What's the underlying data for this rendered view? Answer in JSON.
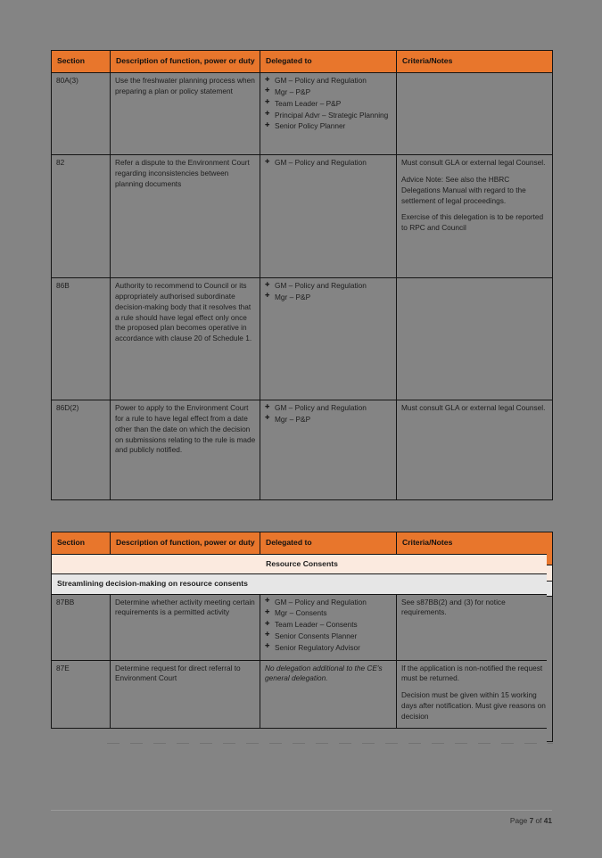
{
  "document": {
    "footer": {
      "page_label_prefix": "Page ",
      "current_page": "7",
      "middle": " of ",
      "total_pages": "41"
    }
  },
  "table1": {
    "headers": {
      "section": "Section",
      "description": "Description of function, power or duty",
      "delegated_to": "Delegated to",
      "criteria": "Criteria/Notes"
    },
    "rows": [
      {
        "section": "80A(3)",
        "description": "Use the freshwater planning process when preparing a plan or policy statement",
        "delegated_to": [
          "GM – Policy and Regulation",
          "Mgr – P&P",
          "Team Leader – P&P",
          "Principal Advr – Strategic Planning",
          "Senior Policy Planner"
        ],
        "criteria": []
      },
      {
        "section": "82",
        "description": "Refer a dispute to the Environment Court regarding inconsistencies between planning documents",
        "delegated_to": [
          "GM – Policy and Regulation"
        ],
        "criteria": [
          "Must consult GLA or external legal Counsel.",
          "Advice Note: See also the HBRC Delegations Manual with regard to the settlement of legal proceedings.",
          "Exercise of this delegation is to be reported to RPC and Council"
        ]
      },
      {
        "section": "86B",
        "description": "Authority to recommend to Council or its appropriately authorised subordinate decision-making body that it resolves that a rule should have legal effect only once the proposed plan becomes operative in accordance with clause 20 of Schedule 1.",
        "delegated_to": [
          "GM – Policy and Regulation",
          "Mgr – P&P"
        ],
        "criteria": []
      },
      {
        "section": "86D(2)",
        "description": "Power to apply to the Environment Court for a rule to have legal effect from a date other than the date on which the decision on submissions relating to the rule is made and publicly notified.",
        "delegated_to": [
          "GM – Policy and Regulation",
          "Mgr – P&P"
        ],
        "criteria": [
          "Must consult GLA or external legal Counsel."
        ]
      }
    ]
  },
  "table2": {
    "headers": {
      "section": "Section",
      "description": "Description of function, power or duty",
      "delegated_to": "Delegated to",
      "criteria": "Criteria/Notes"
    },
    "band_major": "Resource Consents",
    "band_minor": "Streamlining decision-making on resource consents",
    "rows": [
      {
        "section": "87BB",
        "description": "Determine whether activity meeting certain requirements is a permitted activity",
        "delegated_to": [
          "GM – Policy and Regulation",
          "Mgr – Consents",
          "Team Leader – Consents",
          "Senior Consents Planner",
          "Senior Regulatory Advisor"
        ],
        "delegated_italic": false,
        "criteria": [
          "See s87BB(2) and (3) for notice requirements."
        ]
      },
      {
        "section": "87E",
        "description": "Determine request for direct referral to Environment Court",
        "delegated_to_text": "No delegation additional to the CE's general delegation.",
        "delegated_italic": true,
        "criteria": [
          "If the application is non-notified the request must be returned.",
          "Decision must be given within 15 working days after notification. Must give reasons on decision"
        ]
      }
    ]
  },
  "colors": {
    "header_orange": "#E8762C",
    "band_major": "#FBEADF",
    "band_minor": "#E6E6E6",
    "page_background": "#848484"
  }
}
